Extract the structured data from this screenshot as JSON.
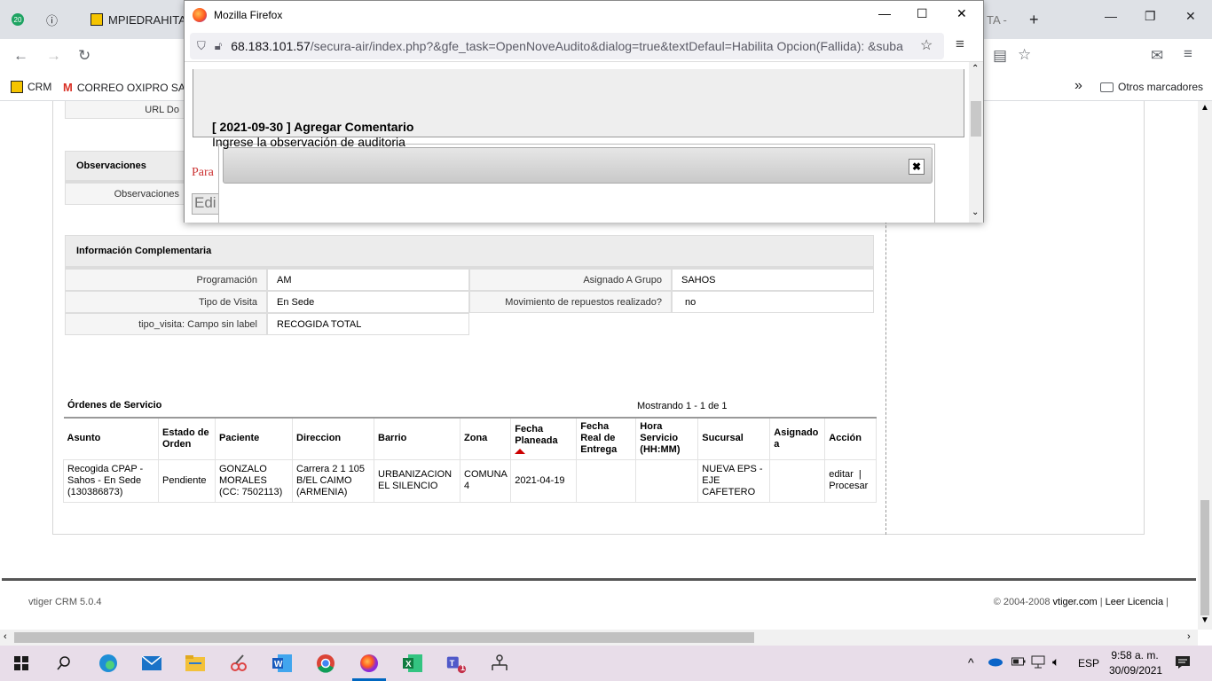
{
  "chrome": {
    "tab_badge": "20",
    "tab1_title": "MPIEDRAHITA -",
    "tab2_title": "TA -",
    "new_tab": "+",
    "bookmarks": [
      {
        "label": "CRM"
      },
      {
        "label": "CORREO OXIPRO SAS"
      }
    ],
    "more_bookmarks": "»",
    "other_bookmarks": "Otros marcadores"
  },
  "popup": {
    "window_title": "Mozilla Firefox",
    "url_host": "68.183.101.57",
    "url_path": "/secura-air/index.php?&gfe_task=OpenNoveAudito&dialog=true&textDefaul=Habilita Opcion(Fallida): &suba",
    "para_text": "Para",
    "edit_btn": "Edi",
    "dialog_title": "[ 2021-09-30 ] Agregar Comentario",
    "dialog_sub": "Ingrese la observación de auditoria"
  },
  "page": {
    "url_label": "URL Do",
    "obs_section": "Observaciones",
    "obs_label": "Observaciones",
    "info_section": "Información Complementaria",
    "info_rows": [
      {
        "l1": "Programación",
        "v1": "AM",
        "l2": "Asignado A Grupo",
        "v2": "SAHOS"
      },
      {
        "l1": "Tipo de Visita",
        "v1": "En Sede",
        "l2": "Movimiento de repuestos realizado?",
        "v2": "no"
      },
      {
        "l1": "tipo_visita: Campo sin label",
        "v1": "RECOGIDA TOTAL"
      }
    ],
    "orders_title": "Órdenes de Servicio",
    "orders_count": "Mostrando 1 - 1 de 1",
    "orders_headers": [
      "Asunto",
      "Estado de Orden",
      "Paciente",
      "Direccion",
      "Barrio",
      "Zona",
      "Fecha Planeada",
      "Fecha Real de Entrega",
      "Hora Servicio (HH:MM)",
      "Sucursal",
      "Asignado a",
      "Acción"
    ],
    "orders_row": {
      "asunto": "Recogida CPAP - Sahos - En Sede (130386873)",
      "estado": "Pendiente",
      "paciente": "GONZALO MORALES (CC: 7502113)",
      "direccion": "Carrera 2 1 105 B/EL CAIMO (ARMENIA)",
      "barrio": "URBANIZACION EL SILENCIO",
      "zona": "COMUNA 4",
      "fecha_planeada": "2021-04-19",
      "fecha_real": "",
      "hora": "",
      "sucursal": "NUEVA EPS - EJE CAFETERO",
      "asignado": "",
      "accion_edit": "editar",
      "accion_sep": "|",
      "accion_proc": "Procesar"
    },
    "footer_left": "vtiger CRM 5.0.4",
    "footer_copy": "© 2004-2008",
    "footer_link1": "vtiger.com",
    "footer_sep": "|",
    "footer_link2": "Leer Licencia",
    "footer_sep2": "|"
  },
  "taskbar": {
    "lang": "ESP",
    "time": "9:58 a. m.",
    "date": "30/09/2021",
    "teams_badge": "1"
  },
  "colors": {
    "accent": "#0067c0",
    "sort_arrow": "#cc0000",
    "para_red": "#cc3333"
  }
}
